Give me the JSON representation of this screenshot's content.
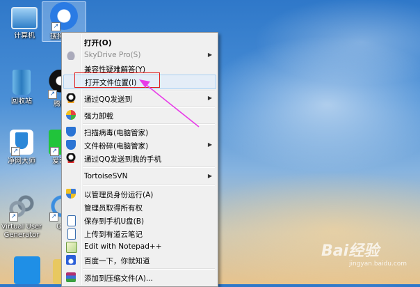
{
  "desktop": {
    "icons": [
      {
        "label": "计算机"
      },
      {
        "label": "搜狗高速"
      },
      {
        "label": "回收站"
      },
      {
        "label": "腾讯"
      },
      {
        "label": "净网大师"
      },
      {
        "label": "爱奇"
      },
      {
        "label": "Virtual User Generator"
      },
      {
        "label": "QQ"
      }
    ]
  },
  "context_menu": {
    "items": [
      {
        "label": "打开(O)"
      },
      {
        "label": "SkyDrive Pro(S)"
      },
      {
        "label": "兼容性疑难解答(Y)"
      },
      {
        "label": "打开文件位置(I)"
      },
      {
        "label": "通过QQ发送到"
      },
      {
        "label": "强力卸载"
      },
      {
        "label": "扫描病毒(电脑管家)"
      },
      {
        "label": "文件粉碎(电脑管家)"
      },
      {
        "label": "通过QQ发送到我的手机"
      },
      {
        "label": "TortoiseSVN"
      },
      {
        "label": "以管理员身份运行(A)"
      },
      {
        "label": "管理员取得所有权"
      },
      {
        "label": "保存到手机U盘(B)"
      },
      {
        "label": "上传到有道云笔记"
      },
      {
        "label": "Edit with Notepad++"
      },
      {
        "label": "百度一下，你就知道"
      },
      {
        "label": "添加到压缩文件(A)..."
      }
    ]
  },
  "watermark": {
    "brand": "Bai经验",
    "url": "jingyan.baidu.com"
  },
  "colors": {
    "highlight_box": "#e02020",
    "arrow": "#e83be8"
  }
}
